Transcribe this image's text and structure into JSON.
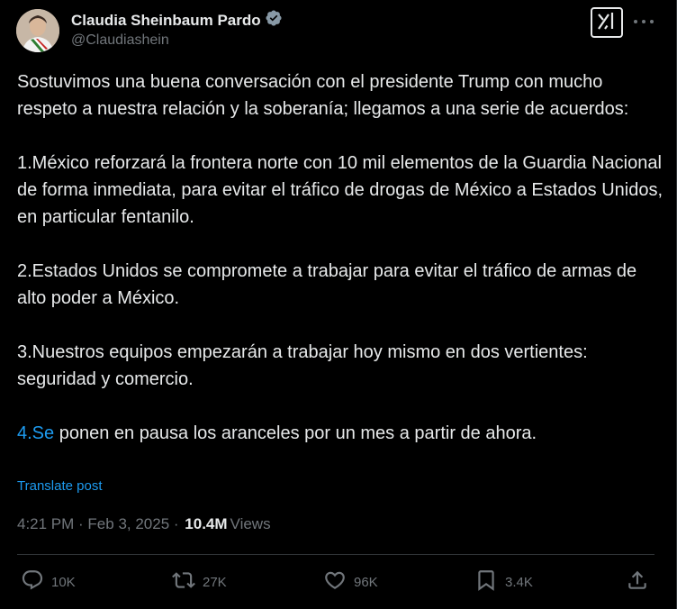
{
  "author": {
    "name": "Claudia Sheinbaum Pardo",
    "handle": "@Claudiashein",
    "verified_color": "#8899a6"
  },
  "header": {
    "grok_icon": "grok-icon",
    "more_icon": "more-icon"
  },
  "post": {
    "p1": "Sostuvimos una buena conversación con el presidente Trump con mucho respeto a nuestra relación y la soberanía; llegamos a una serie de acuerdos:",
    "p2": "1.México reforzará la frontera norte con 10 mil elementos de la Guardia Nacional de forma inmediata, para evitar el tráfico de drogas de México a Estados Unidos, en particular fentanilo.",
    "p3": "2.Estados Unidos se compromete a trabajar para evitar el tráfico de armas de alto poder a México.",
    "p4": "3.Nuestros equipos empezarán a trabajar hoy mismo en dos vertientes: seguridad y comercio.",
    "p5_link": "4.Se",
    "p5_rest": " ponen en pausa los aranceles por un mes a partir de ahora.",
    "translate_label": "Translate post"
  },
  "meta": {
    "time": "4:21 PM",
    "sep1": " · ",
    "date": "Feb 3, 2025",
    "sep2": " · ",
    "views_count": "10.4M",
    "views_label": "Views"
  },
  "actions": {
    "replies": "10K",
    "reposts": "27K",
    "likes": "96K",
    "bookmarks": "3.4K"
  },
  "colors": {
    "background": "#000000",
    "text": "#e7e9ea",
    "secondary": "#71767b",
    "link": "#1d9bf0",
    "divider": "#2f3336"
  }
}
